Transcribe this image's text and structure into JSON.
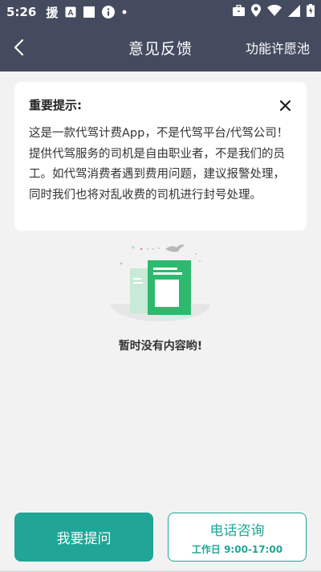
{
  "status_bar": {
    "time": "5:26",
    "icons_left": [
      "援",
      "A",
      "■",
      "i",
      "•"
    ],
    "icons_right": [
      "briefcase-icon",
      "location-icon",
      "wifi-icon",
      "signal-icon",
      "battery-icon"
    ]
  },
  "header": {
    "title": "意见反馈",
    "right_action": "功能许愿池"
  },
  "notice": {
    "title": "重要提示:",
    "body": "这是一款代驾计费App，不是代驾平台/代驾公司！提供代驾服务的司机是自由职业者，不是我们的员工。如代驾消费者遇到费用问题，建议报警处理，同时我们也将对乱收费的司机进行封号处理。"
  },
  "empty_state": {
    "text": "暂时没有内容哟!"
  },
  "buttons": {
    "ask": "我要提问",
    "phone_main": "电话咨询",
    "phone_sub": "工作日 9:00-17:00"
  },
  "colors": {
    "header_bg": "#454b5f",
    "accent": "#20a596",
    "page_bg": "#f2f2f2"
  }
}
